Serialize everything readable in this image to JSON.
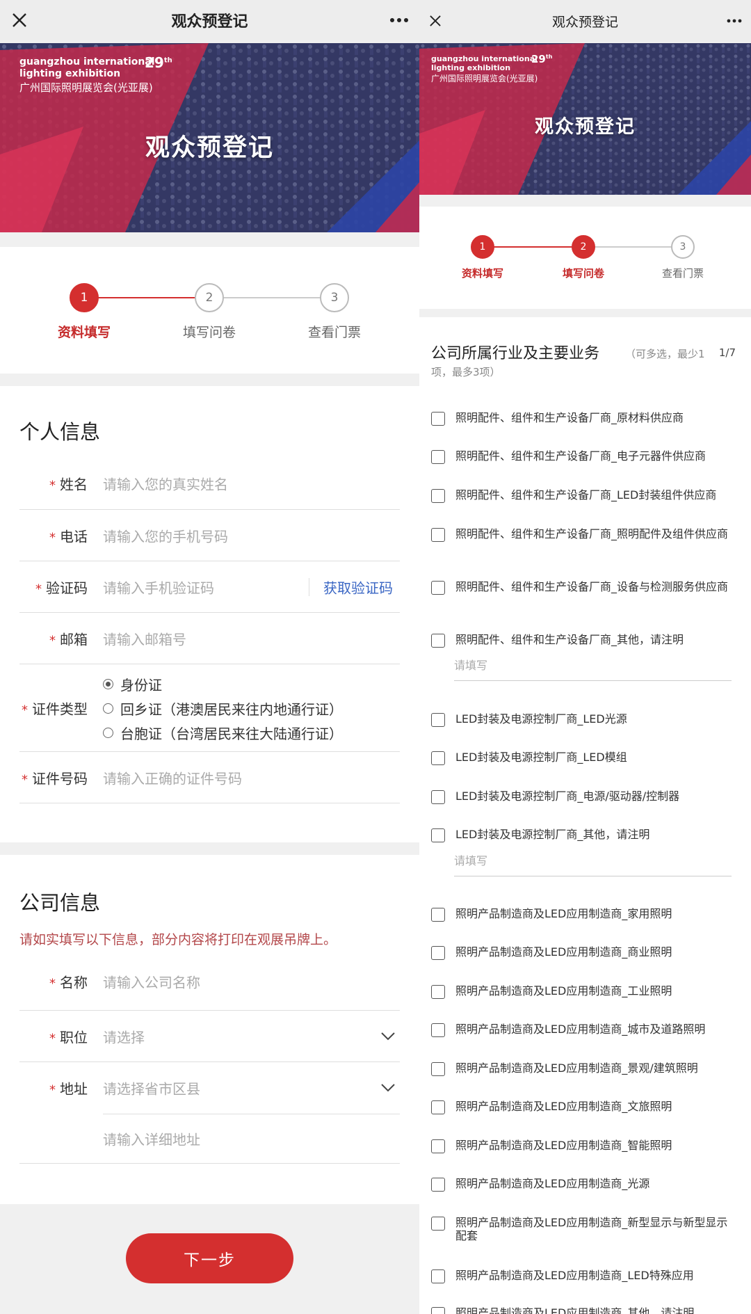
{
  "left": {
    "nav": {
      "title": "观众预登记"
    },
    "banner": {
      "brand_en_1": "guangzhou international",
      "brand_en_2": "lighting exhibition",
      "edition": "29",
      "edition_suffix": "th",
      "brand_cn": "广州国际照明展览会(光亚展)",
      "title": "观众预登记"
    },
    "steps": [
      {
        "num": "1",
        "label": "资料填写"
      },
      {
        "num": "2",
        "label": "填写问卷"
      },
      {
        "num": "3",
        "label": "查看门票"
      }
    ],
    "personal": {
      "title": "个人信息",
      "required_mark": "*",
      "name": {
        "label": "姓名",
        "placeholder": "请输入您的真实姓名"
      },
      "phone": {
        "label": "电话",
        "placeholder": "请输入您的手机号码"
      },
      "code": {
        "label": "验证码",
        "placeholder": "请输入手机验证码",
        "action": "获取验证码"
      },
      "email": {
        "label": "邮箱",
        "placeholder": "请输入邮箱号"
      },
      "id_type": {
        "label": "证件类型",
        "options": [
          "身份证",
          "回乡证（港澳居民来往内地通行证）",
          "台胞证（台湾居民来往大陆通行证）"
        ],
        "selected": "身份证"
      },
      "id_no": {
        "label": "证件号码",
        "placeholder": "请输入正确的证件号码"
      }
    },
    "company": {
      "title": "公司信息",
      "hint": "请如实填写以下信息，部分内容将打印在观展吊牌上。",
      "name": {
        "label": "名称",
        "placeholder": "请输入公司名称"
      },
      "position": {
        "label": "职位",
        "placeholder": "请选择"
      },
      "address": {
        "label": "地址",
        "placeholder": "请选择省市区县",
        "detail_placeholder": "请输入详细地址"
      }
    },
    "next": "下一步"
  },
  "right": {
    "nav": {
      "title": "观众预登记"
    },
    "banner": {
      "brand_en_1": "guangzhou international",
      "brand_en_2": "lighting exhibition",
      "edition": "29",
      "edition_suffix": "th",
      "brand_cn": "广州国际照明展览会(光亚展)",
      "title": "观众预登记"
    },
    "steps": [
      {
        "num": "1",
        "label": "资料填写"
      },
      {
        "num": "2",
        "label": "填写问卷"
      },
      {
        "num": "3",
        "label": "查看门票"
      }
    ],
    "question": {
      "title": "公司所属行业及主要业务",
      "sub": "（可多选，最少1",
      "sub2": "项，最多3项）",
      "counter": "1/7",
      "fill_placeholder": "请填写",
      "options": [
        "照明配件、组件和生产设备厂商_原材料供应商",
        "照明配件、组件和生产设备厂商_电子元器件供应商",
        "照明配件、组件和生产设备厂商_LED封装组件供应商",
        "照明配件、组件和生产设备厂商_照明配件及组件供应商",
        "照明配件、组件和生产设备厂商_设备与检测服务供应商",
        "照明配件、组件和生产设备厂商_其他，请注明",
        "LED封装及电源控制厂商_LED光源",
        "LED封装及电源控制厂商_LED模组",
        "LED封装及电源控制厂商_电源/驱动器/控制器",
        "LED封装及电源控制厂商_其他，请注明",
        "照明产品制造商及LED应用制造商_家用照明",
        "照明产品制造商及LED应用制造商_商业照明",
        "照明产品制造商及LED应用制造商_工业照明",
        "照明产品制造商及LED应用制造商_城市及道路照明",
        "照明产品制造商及LED应用制造商_景观/建筑照明",
        "照明产品制造商及LED应用制造商_文旅照明",
        "照明产品制造商及LED应用制造商_智能照明",
        "照明产品制造商及LED应用制造商_光源",
        "照明产品制造商及LED应用制造商_新型显示与新型显示配套",
        "照明产品制造商及LED应用制造商_LED特殊应用",
        "照明产品制造商及LED应用制造商_其他，请注明"
      ]
    }
  }
}
